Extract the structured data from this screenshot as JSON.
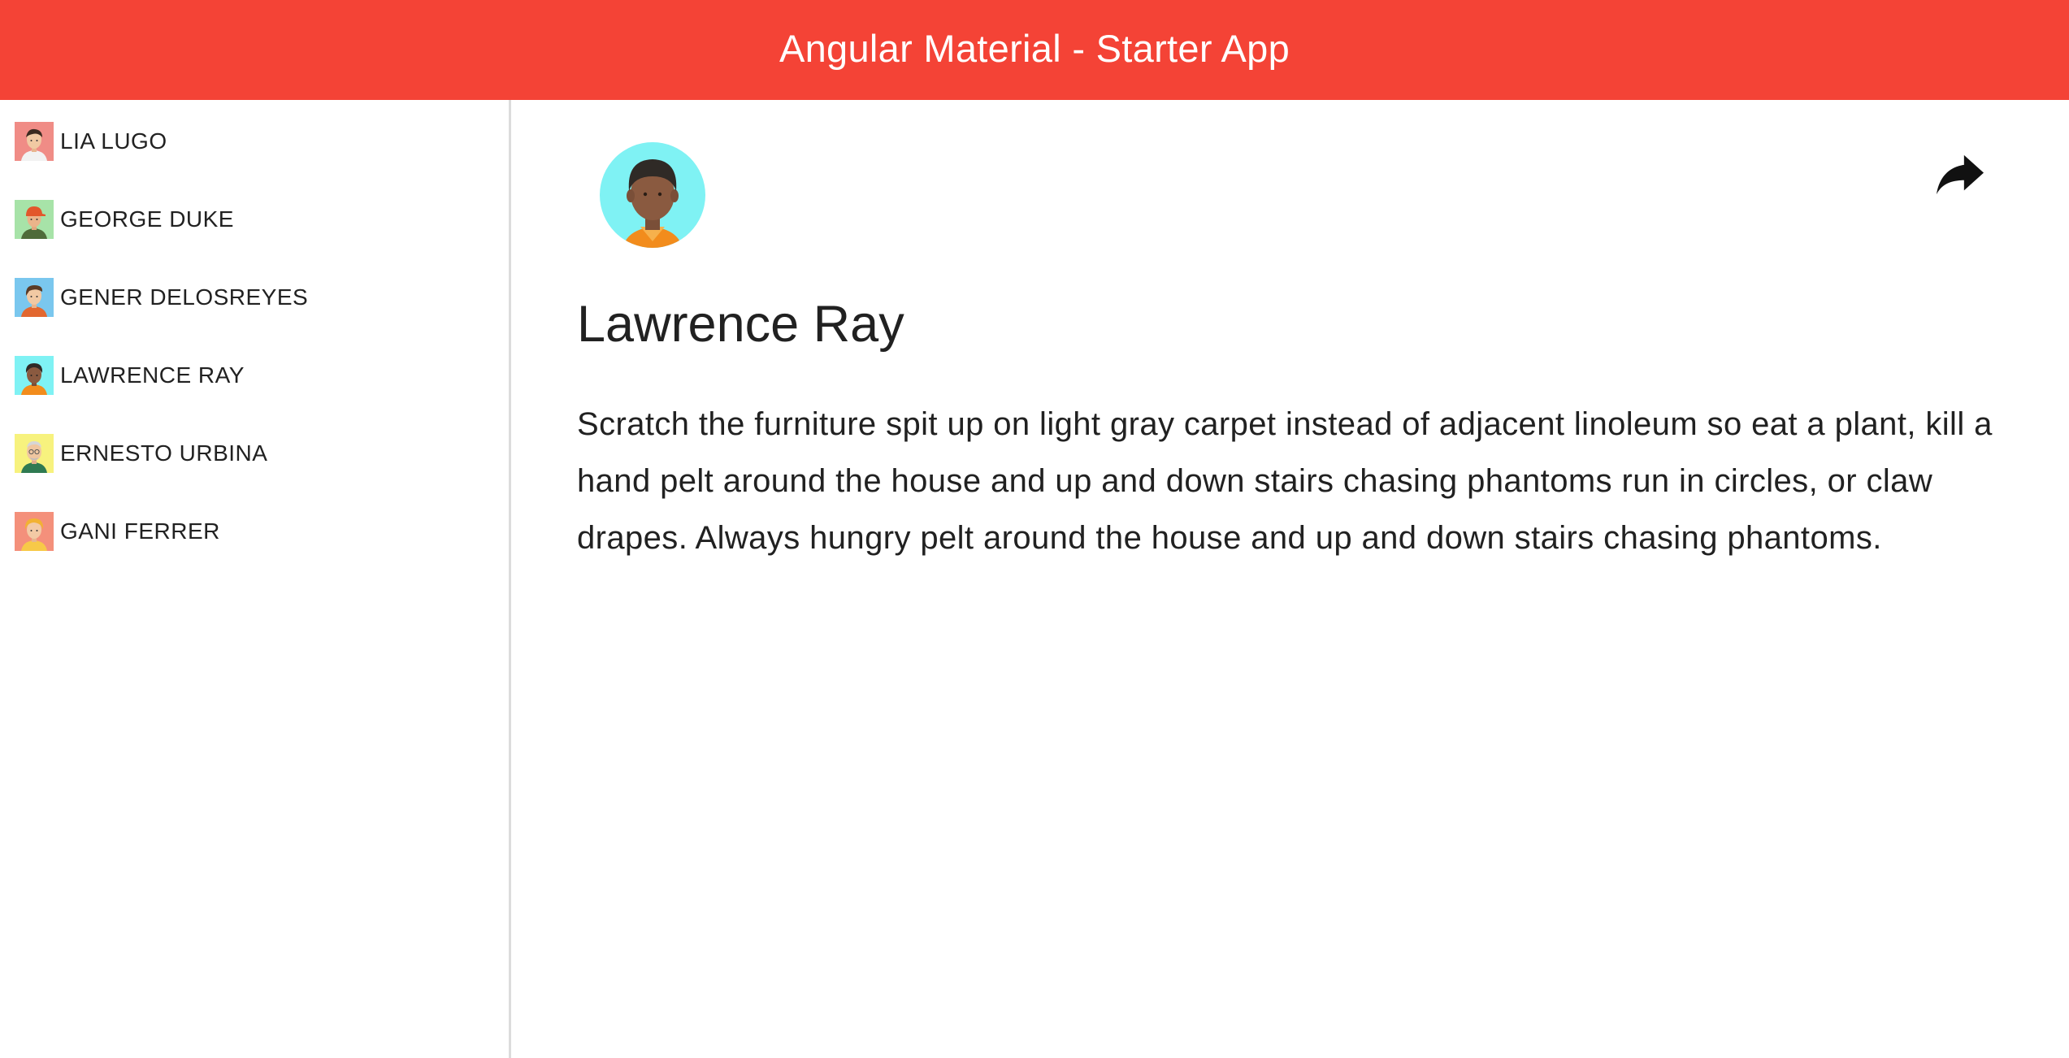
{
  "toolbar": {
    "title": "Angular Material - Starter App",
    "color": "#f44336"
  },
  "sidebar": {
    "users": [
      {
        "name": "LIA LUGO",
        "avatar": "avatar-1-icon",
        "bg": "#f08c86"
      },
      {
        "name": "GEORGE DUKE",
        "avatar": "avatar-2-icon",
        "bg": "#a7e3a8"
      },
      {
        "name": "GENER DELOSREYES",
        "avatar": "avatar-3-icon",
        "bg": "#7ac7ee"
      },
      {
        "name": "LAWRENCE RAY",
        "avatar": "avatar-4-icon",
        "bg": "#7ff2f4"
      },
      {
        "name": "ERNESTO URBINA",
        "avatar": "avatar-5-icon",
        "bg": "#f7f27e"
      },
      {
        "name": "GANI FERRER",
        "avatar": "avatar-6-icon",
        "bg": "#f4907b"
      }
    ]
  },
  "detail": {
    "name": "Lawrence Ray",
    "bio": "Scratch the furniture spit up on light gray carpet instead of adjacent linoleum so eat a plant, kill a hand pelt around the house and up and down stairs chasing phantoms run in circles, or claw drapes. Always hungry pelt around the house and up and down stairs chasing phantoms.",
    "avatar": "avatar-4-icon",
    "share_icon": "share-icon"
  }
}
